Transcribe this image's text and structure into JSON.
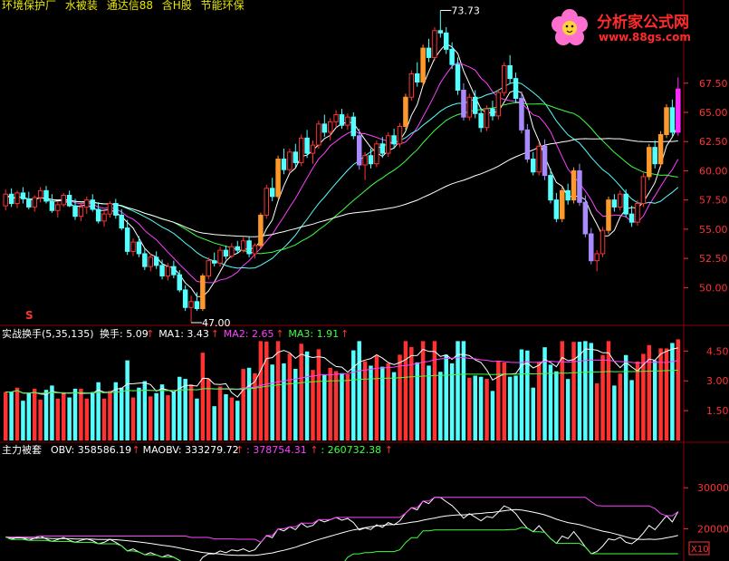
{
  "header": {
    "tags": [
      {
        "label": "环境保护厂",
        "color": "#e8e800"
      },
      {
        "label": "水被装",
        "color": "#e8e800"
      },
      {
        "label": "通达信88",
        "color": "#e8e800"
      },
      {
        "label": "含H股",
        "color": "#e8e800"
      },
      {
        "label": "节能环保",
        "color": "#e8e800"
      }
    ]
  },
  "watermark": {
    "title": "分析家公式网",
    "url": "www.88gs.com"
  },
  "colors": {
    "background": "#000000",
    "grid": "#8b0000",
    "up": "#ff3232",
    "down": "#54ffff",
    "highlight_orange": "#ff9a2a",
    "highlight_violet": "#a98bff",
    "highlight_magenta": "#ff2aff",
    "white": "#ffffff",
    "yellow": "#ffff00",
    "magenta": "#ff40ff",
    "green": "#40ff40",
    "axis_text": "#ff3232"
  },
  "chart_data": [
    {
      "type": "candlestick",
      "panel": "price",
      "y_axis_ticks": [
        "67.50",
        "65.00",
        "62.50",
        "60.00",
        "57.50",
        "55.00",
        "52.50",
        "50.00"
      ],
      "ylim": [
        47.0,
        74.0
      ],
      "annotations": [
        {
          "label": "73.73",
          "value": 73.73
        },
        {
          "label": "47.00",
          "value": 47.0
        }
      ],
      "marker": "S",
      "candles": [
        [
          57.0,
          58.4,
          56.6,
          58.0
        ],
        [
          58.0,
          58.5,
          56.9,
          57.2
        ],
        [
          57.2,
          58.3,
          56.8,
          58.1
        ],
        [
          58.1,
          58.6,
          57.2,
          57.6
        ],
        [
          57.6,
          58.2,
          56.7,
          56.9
        ],
        [
          56.9,
          57.9,
          56.5,
          57.7
        ],
        [
          57.7,
          58.6,
          57.3,
          58.3
        ],
        [
          58.3,
          58.7,
          57.2,
          57.4
        ],
        [
          57.4,
          58.0,
          56.4,
          56.6
        ],
        [
          56.6,
          57.4,
          56.0,
          57.1
        ],
        [
          57.1,
          58.1,
          56.9,
          57.9
        ],
        [
          57.9,
          58.3,
          56.9,
          57.0
        ],
        [
          57.0,
          57.6,
          55.8,
          56.1
        ],
        [
          56.1,
          57.2,
          55.7,
          56.9
        ],
        [
          56.9,
          57.8,
          56.3,
          57.5
        ],
        [
          57.5,
          58.0,
          56.5,
          56.7
        ],
        [
          56.7,
          57.3,
          55.5,
          55.7
        ],
        [
          55.7,
          56.6,
          55.2,
          56.3
        ],
        [
          56.3,
          57.4,
          56.0,
          57.2
        ],
        [
          57.2,
          57.6,
          55.9,
          56.2
        ],
        [
          56.2,
          56.7,
          54.9,
          55.1
        ],
        [
          55.1,
          55.8,
          52.8,
          53.1
        ],
        [
          53.1,
          54.2,
          52.7,
          53.9
        ],
        [
          53.9,
          54.4,
          52.6,
          52.9
        ],
        [
          52.9,
          53.4,
          51.5,
          51.8
        ],
        [
          51.8,
          52.9,
          51.4,
          52.6
        ],
        [
          52.6,
          53.1,
          51.6,
          51.9
        ],
        [
          51.9,
          52.4,
          50.7,
          51.0
        ],
        [
          51.0,
          52.1,
          50.6,
          51.8
        ],
        [
          51.8,
          52.3,
          50.8,
          51.1
        ],
        [
          51.1,
          51.5,
          49.6,
          49.8
        ],
        [
          49.8,
          50.2,
          48.0,
          48.3
        ],
        [
          48.3,
          49.3,
          47.0,
          48.8
        ],
        [
          48.8,
          49.6,
          48.0,
          48.2
        ],
        [
          48.2,
          51.2,
          48.0,
          51.0
        ],
        [
          51.0,
          52.6,
          50.7,
          52.3
        ],
        [
          52.3,
          53.0,
          51.8,
          52.1
        ],
        [
          52.1,
          53.5,
          51.8,
          53.2
        ],
        [
          53.2,
          53.6,
          52.4,
          52.7
        ],
        [
          52.7,
          53.8,
          52.5,
          53.5
        ],
        [
          53.5,
          54.0,
          52.9,
          53.2
        ],
        [
          53.2,
          54.3,
          53.0,
          54.0
        ],
        [
          54.0,
          54.4,
          52.6,
          52.9
        ],
        [
          52.9,
          53.8,
          52.5,
          53.6
        ],
        [
          53.6,
          56.4,
          53.3,
          56.2
        ],
        [
          56.2,
          58.8,
          55.9,
          58.5
        ],
        [
          58.5,
          59.4,
          57.4,
          57.8
        ],
        [
          57.8,
          61.3,
          57.6,
          61.0
        ],
        [
          61.0,
          61.9,
          59.7,
          60.1
        ],
        [
          60.1,
          61.9,
          59.8,
          61.6
        ],
        [
          61.6,
          62.3,
          60.3,
          60.7
        ],
        [
          60.7,
          63.1,
          60.4,
          62.8
        ],
        [
          62.8,
          63.5,
          61.1,
          61.5
        ],
        [
          61.5,
          62.6,
          60.6,
          62.2
        ],
        [
          62.2,
          64.3,
          61.9,
          64.0
        ],
        [
          64.0,
          64.8,
          62.9,
          63.3
        ],
        [
          63.3,
          64.5,
          62.6,
          64.2
        ],
        [
          64.2,
          65.2,
          63.7,
          64.8
        ],
        [
          64.8,
          65.3,
          63.6,
          63.9
        ],
        [
          63.9,
          64.9,
          63.5,
          64.6
        ],
        [
          64.6,
          65.0,
          62.7,
          63.0
        ],
        [
          63.0,
          63.6,
          60.1,
          60.5
        ],
        [
          60.5,
          61.6,
          59.2,
          61.3
        ],
        [
          61.3,
          61.9,
          60.2,
          60.6
        ],
        [
          60.6,
          62.6,
          60.3,
          62.3
        ],
        [
          62.3,
          62.9,
          61.1,
          61.5
        ],
        [
          61.5,
          63.3,
          61.2,
          63.0
        ],
        [
          63.0,
          63.6,
          61.9,
          62.3
        ],
        [
          62.3,
          64.1,
          62.0,
          63.8
        ],
        [
          63.8,
          66.6,
          63.5,
          66.3
        ],
        [
          66.3,
          68.6,
          66.0,
          68.3
        ],
        [
          68.3,
          69.3,
          67.2,
          67.6
        ],
        [
          67.6,
          70.8,
          67.3,
          70.5
        ],
        [
          70.5,
          71.3,
          69.3,
          69.7
        ],
        [
          69.7,
          72.3,
          69.4,
          72.0
        ],
        [
          72.0,
          73.73,
          71.4,
          71.8
        ],
        [
          71.8,
          72.3,
          70.0,
          70.4
        ],
        [
          70.4,
          71.0,
          68.7,
          69.1
        ],
        [
          69.1,
          69.7,
          66.5,
          66.9
        ],
        [
          66.9,
          67.5,
          64.3,
          64.6
        ],
        [
          64.6,
          66.6,
          64.3,
          66.3
        ],
        [
          66.3,
          66.9,
          64.5,
          64.9
        ],
        [
          64.9,
          65.4,
          63.3,
          63.7
        ],
        [
          63.7,
          65.6,
          63.4,
          65.3
        ],
        [
          65.3,
          66.0,
          64.3,
          64.7
        ],
        [
          64.7,
          67.0,
          64.4,
          66.7
        ],
        [
          66.7,
          69.3,
          66.4,
          69.0
        ],
        [
          69.0,
          69.9,
          67.5,
          67.9
        ],
        [
          67.9,
          68.4,
          65.8,
          66.2
        ],
        [
          66.2,
          66.8,
          63.2,
          63.5
        ],
        [
          63.5,
          64.0,
          60.7,
          61.0
        ],
        [
          61.0,
          61.6,
          59.6,
          59.9
        ],
        [
          59.9,
          62.4,
          59.6,
          62.1
        ],
        [
          62.1,
          62.7,
          59.2,
          59.6
        ],
        [
          59.6,
          60.2,
          57.2,
          57.5
        ],
        [
          57.5,
          58.1,
          55.6,
          55.9
        ],
        [
          55.9,
          58.6,
          55.6,
          58.3
        ],
        [
          58.3,
          58.9,
          57.1,
          57.5
        ],
        [
          57.5,
          60.3,
          57.2,
          60.0
        ],
        [
          60.0,
          60.6,
          57.0,
          57.3
        ],
        [
          57.3,
          57.9,
          54.3,
          54.6
        ],
        [
          54.6,
          55.1,
          52.0,
          52.3
        ],
        [
          52.3,
          53.2,
          51.4,
          52.9
        ],
        [
          52.9,
          55.2,
          52.6,
          54.9
        ],
        [
          54.9,
          57.8,
          54.6,
          57.5
        ],
        [
          57.5,
          58.0,
          56.5,
          56.9
        ],
        [
          56.9,
          58.3,
          56.6,
          58.0
        ],
        [
          58.0,
          58.4,
          56.0,
          56.3
        ],
        [
          56.3,
          57.0,
          55.2,
          55.6
        ],
        [
          55.6,
          57.5,
          55.3,
          57.2
        ],
        [
          57.2,
          59.8,
          56.9,
          59.5
        ],
        [
          59.5,
          62.3,
          59.2,
          62.0
        ],
        [
          62.0,
          62.6,
          60.2,
          60.6
        ],
        [
          60.6,
          63.4,
          60.3,
          63.1
        ],
        [
          63.1,
          65.7,
          62.8,
          65.4
        ],
        [
          65.4,
          66.1,
          62.9,
          63.3
        ],
        [
          63.3,
          68.0,
          63.0,
          67.0
        ]
      ],
      "ma_lines": [
        {
          "name": "MA-white-short",
          "color": "#ffffff",
          "period": 5
        },
        {
          "name": "MA-magenta",
          "color": "#ff40ff",
          "period": 10
        },
        {
          "name": "MA-cyan",
          "color": "#54ffff",
          "period": 20
        },
        {
          "name": "MA-green",
          "color": "#40ff40",
          "period": 30
        },
        {
          "name": "MA-white-long",
          "color": "#ffffff",
          "period": 60
        }
      ]
    },
    {
      "type": "bar",
      "panel": "turnover",
      "title": "实战换手(5,35,135)",
      "legend": [
        {
          "label": "换手: 5.09",
          "color": "#ffffff"
        },
        {
          "label": "MA1: 3.43",
          "color": "#ffffff"
        },
        {
          "label": "MA2: 2.65",
          "color": "#ff40ff"
        },
        {
          "label": "MA3: 1.91",
          "color": "#40ff40"
        }
      ],
      "y_axis_ticks": [
        "4.50",
        "3.00",
        "1.50"
      ],
      "ylim": [
        0,
        5.2
      ],
      "series_colors": {
        "MA1": "#ffffff",
        "MA2": "#ff40ff",
        "MA3": "#40ff40"
      }
    },
    {
      "type": "line",
      "panel": "obv",
      "title": "主力被套",
      "legend": [
        {
          "label": "OBV: 358586.19",
          "color": "#ffffff"
        },
        {
          "label": "MAOBV: 333279.72",
          "color": "#ffffff"
        },
        {
          "label": ": 378754.31",
          "color": "#ff40ff"
        },
        {
          "label": ": 260732.38",
          "color": "#40ff40"
        }
      ],
      "y_axis_ticks": [
        "30000",
        "20000"
      ],
      "y_axis_unit": "X10",
      "ylim": [
        15000,
        38000
      ]
    }
  ]
}
